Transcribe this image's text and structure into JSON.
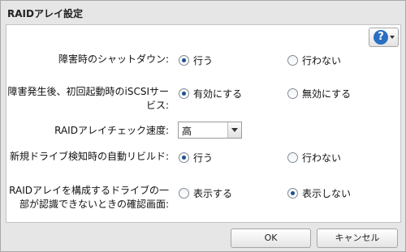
{
  "dialog": {
    "title": "RAIDアレイ設定",
    "help_icon": "question-icon",
    "ok_label": "OK",
    "cancel_label": "キャンセル"
  },
  "form": {
    "shutdown": {
      "label": "障害時のシャットダウン:",
      "options": [
        "行う",
        "行わない"
      ],
      "selected": "行う"
    },
    "iscsi": {
      "label_line1": "障害発生後、初回起動時のiSCSIサー",
      "label_line2": "ビス:",
      "options": [
        "有効にする",
        "無効にする"
      ],
      "selected": "有効にする"
    },
    "check_speed": {
      "label": "RAIDアレイチェック速度:",
      "value": "高"
    },
    "auto_rebuild": {
      "label": "新規ドライブ検知時の自動リビルド:",
      "options": [
        "行う",
        "行わない"
      ],
      "selected": "行う"
    },
    "confirm_screen": {
      "label_line1": "RAIDアレイを構成するドライブの一",
      "label_line2": "部が認識できないときの確認画面:",
      "options": [
        "表示する",
        "表示しない"
      ],
      "selected": "表示しない"
    }
  }
}
